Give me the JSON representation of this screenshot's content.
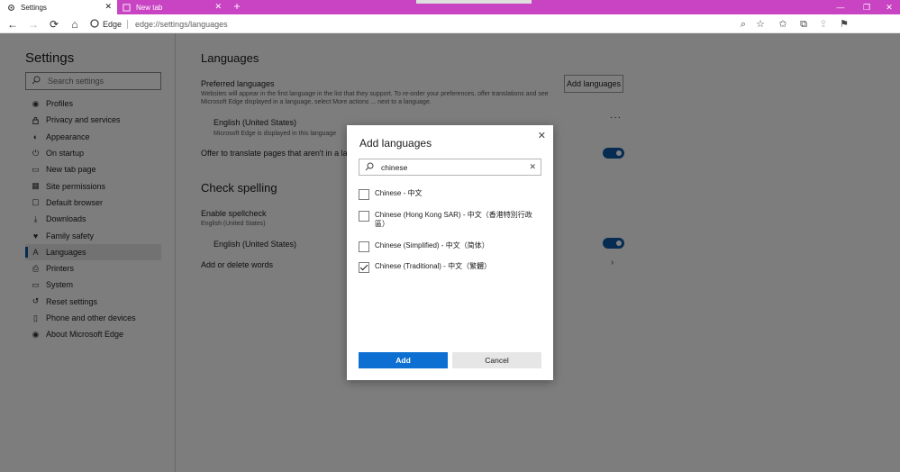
{
  "tabs": [
    {
      "title": "Settings",
      "close": "✕"
    },
    {
      "title": "New tab",
      "close": "✕"
    }
  ],
  "new_tab_symbol": "+",
  "window_controls": [
    "—",
    "❐",
    "✕"
  ],
  "toolbar": {
    "back": "←",
    "forward": "→",
    "refresh": "⟳",
    "home": "⌂",
    "brand": "Edge",
    "url": "edge://settings/languages",
    "right_icons": [
      "zoom-icon",
      "favorite-star-icon",
      "favorites-icon",
      "collections-icon",
      "share-icon",
      "feedback-icon"
    ]
  },
  "sidebar": {
    "title": "Settings",
    "search_placeholder": "Search settings",
    "items": [
      {
        "label": "Profiles",
        "icon": "profile-icon",
        "glyph": "◉"
      },
      {
        "label": "Privacy and services",
        "icon": "lock-icon",
        "glyph": "🔒"
      },
      {
        "label": "Appearance",
        "icon": "appearance-icon",
        "glyph": "◐"
      },
      {
        "label": "On startup",
        "icon": "power-icon",
        "glyph": "⏻"
      },
      {
        "label": "New tab page",
        "icon": "newtab-icon",
        "glyph": "▭"
      },
      {
        "label": "Site permissions",
        "icon": "permissions-icon",
        "glyph": "▦"
      },
      {
        "label": "Default browser",
        "icon": "browser-icon",
        "glyph": "▢"
      },
      {
        "label": "Downloads",
        "icon": "download-icon",
        "glyph": "⤓"
      },
      {
        "label": "Family safety",
        "icon": "family-icon",
        "glyph": "♥"
      },
      {
        "label": "Languages",
        "icon": "languages-icon",
        "glyph": "A"
      },
      {
        "label": "Printers",
        "icon": "printer-icon",
        "glyph": "⎙"
      },
      {
        "label": "System",
        "icon": "system-icon",
        "glyph": "▭"
      },
      {
        "label": "Reset settings",
        "icon": "reset-icon",
        "glyph": "↺"
      },
      {
        "label": "Phone and other devices",
        "icon": "phone-icon",
        "glyph": "▯"
      },
      {
        "label": "About Microsoft Edge",
        "icon": "edge-icon",
        "glyph": "◉"
      }
    ],
    "selected_index": 9
  },
  "main": {
    "languages_heading": "Languages",
    "preferred_label": "Preferred languages",
    "preferred_desc": "Websites will appear in the first language in the list that they support. To re-order your preferences, offer translations and see Microsoft Edge displayed in a language, select More actions ... next to a language.",
    "add_languages_button": "Add languages",
    "lang_name": "English (United States)",
    "lang_desc": "Microsoft Edge is displayed in this language",
    "more_actions": "···",
    "offer_translate": "Offer to translate pages that aren't in a language you read",
    "check_spelling_heading": "Check spelling",
    "enable_spellcheck": "Enable spellcheck",
    "spellcheck_sub": "English (United States)",
    "spell_lang": "English (United States)",
    "add_delete_words": "Add or delete words",
    "chevron": "›"
  },
  "dialog": {
    "title": "Add languages",
    "close": "✕",
    "search_value": "chinese",
    "clear": "✕",
    "options": [
      {
        "label": "Chinese - 中文",
        "checked": false
      },
      {
        "label": "Chinese (Hong Kong SAR) - 中文（香港特別行政區）",
        "checked": false
      },
      {
        "label": "Chinese (Simplified) - 中文（简体）",
        "checked": false
      },
      {
        "label": "Chinese (Traditional) - 中文（繁體）",
        "checked": true
      }
    ],
    "add_button": "Add",
    "cancel_button": "Cancel"
  },
  "colors": {
    "tabstrip": "#c944c3",
    "accent": "#0c59a4",
    "primary_button": "#0c6fd1"
  }
}
